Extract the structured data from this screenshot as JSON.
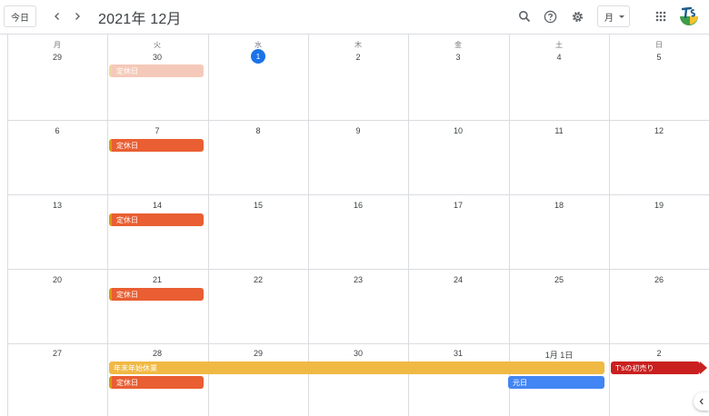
{
  "header": {
    "today_label": "今日",
    "prev_icon": "chevron-left-icon",
    "next_icon": "chevron-right-icon",
    "month_title": "2021年 12月",
    "view_label": "月"
  },
  "weekdays": [
    "月",
    "火",
    "水",
    "木",
    "金",
    "土",
    "日"
  ],
  "weeks": [
    {
      "days": [
        "29",
        "30",
        "1",
        "2",
        "3",
        "4",
        "5"
      ]
    },
    {
      "days": [
        "6",
        "7",
        "8",
        "9",
        "10",
        "11",
        "12"
      ]
    },
    {
      "days": [
        "13",
        "14",
        "15",
        "16",
        "17",
        "18",
        "19"
      ]
    },
    {
      "days": [
        "20",
        "21",
        "22",
        "23",
        "24",
        "25",
        "26"
      ]
    },
    {
      "days": [
        "27",
        "28",
        "29",
        "30",
        "31",
        "1月 1日",
        "2"
      ]
    }
  ],
  "today_day": "1",
  "events": {
    "w0_holiday": "定休日",
    "w1_holiday": "定休日",
    "w2_holiday": "定休日",
    "w3_holiday": "定休日",
    "w4_newyear_break": "年末年始休業",
    "w4_holiday": "定休日",
    "w4_ganjitsu": "元日",
    "w4_first_sale": "T'sの初売り"
  },
  "colors": {
    "holiday": "#e95e32",
    "newyear_break": "#f0b943",
    "ganjitsu": "#4285f4",
    "first_sale": "#c9201f",
    "today": "#1a73e8"
  }
}
